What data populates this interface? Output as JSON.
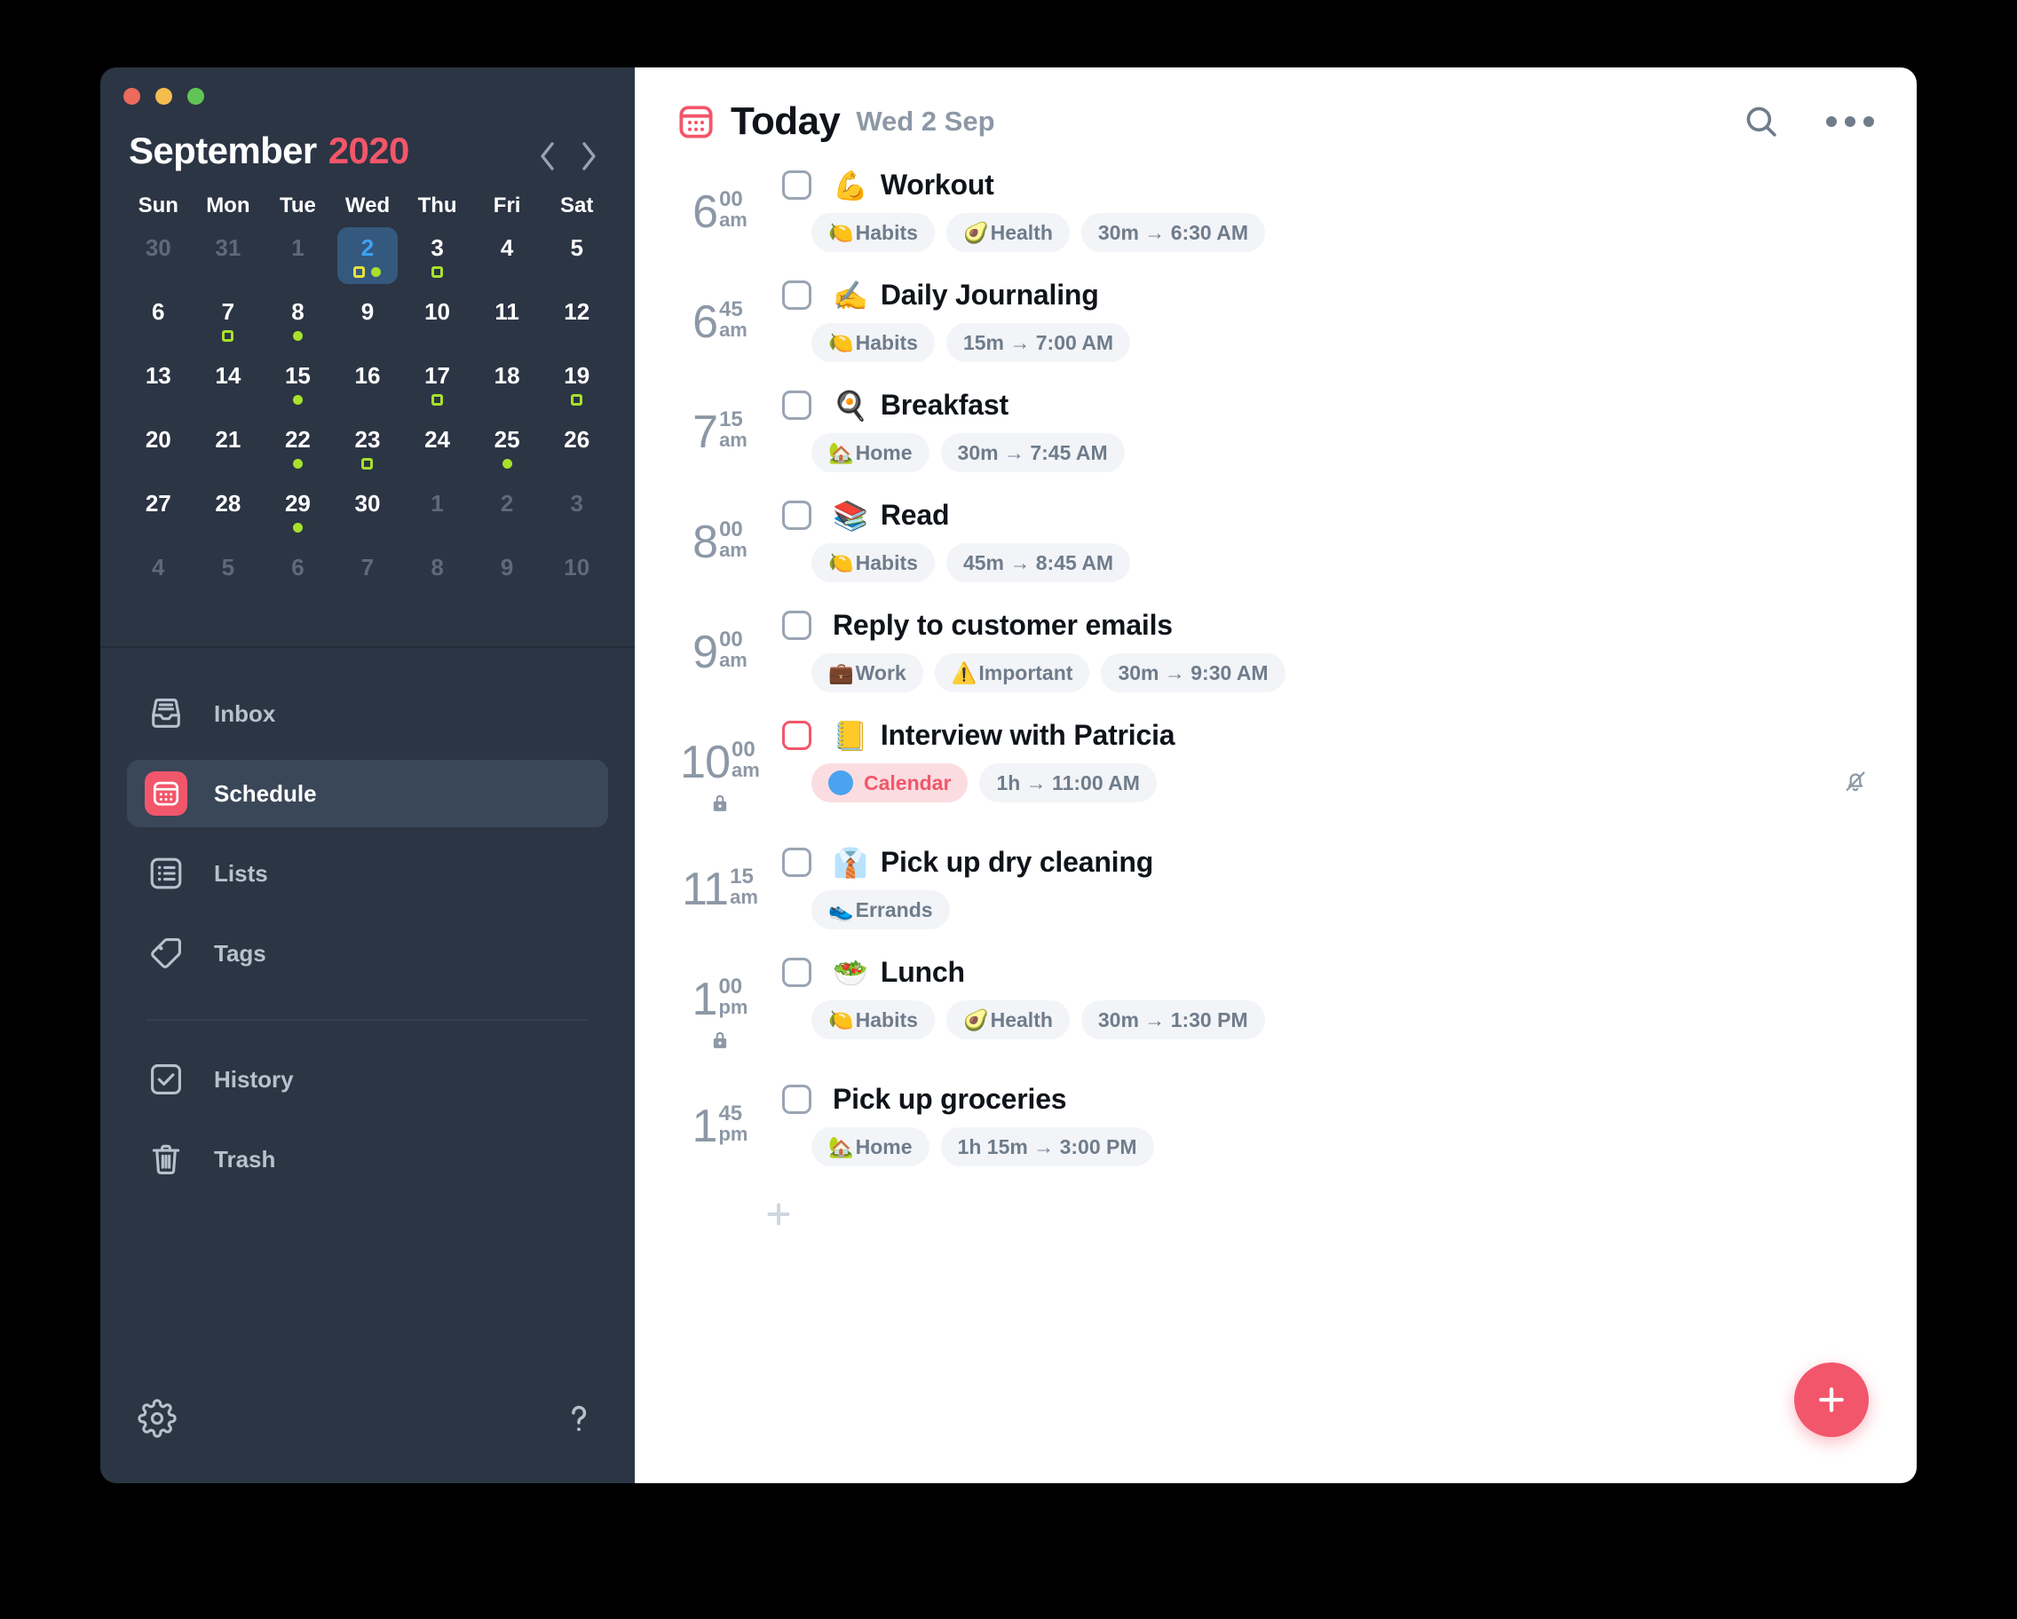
{
  "window": {
    "traffic_lights": [
      "close",
      "minimize",
      "zoom"
    ]
  },
  "sidebar": {
    "calendar": {
      "month": "September",
      "year": "2020",
      "prev_label": "Previous month",
      "next_label": "Next month",
      "weekdays": [
        "Sun",
        "Mon",
        "Tue",
        "Wed",
        "Thu",
        "Fri",
        "Sat"
      ],
      "weeks": [
        [
          {
            "day": "30",
            "muted": true,
            "marks": []
          },
          {
            "day": "31",
            "muted": true,
            "marks": []
          },
          {
            "day": "1",
            "muted": true,
            "marks": []
          },
          {
            "day": "2",
            "muted": false,
            "selected": true,
            "marks": [
              "square",
              "dot"
            ]
          },
          {
            "day": "3",
            "muted": false,
            "marks": [
              "square"
            ]
          },
          {
            "day": "4",
            "muted": false,
            "marks": []
          },
          {
            "day": "5",
            "muted": false,
            "marks": []
          }
        ],
        [
          {
            "day": "6",
            "muted": false,
            "marks": []
          },
          {
            "day": "7",
            "muted": false,
            "marks": [
              "square"
            ]
          },
          {
            "day": "8",
            "muted": false,
            "marks": [
              "dot"
            ]
          },
          {
            "day": "9",
            "muted": false,
            "marks": []
          },
          {
            "day": "10",
            "muted": false,
            "marks": []
          },
          {
            "day": "11",
            "muted": false,
            "marks": []
          },
          {
            "day": "12",
            "muted": false,
            "marks": []
          }
        ],
        [
          {
            "day": "13",
            "muted": false,
            "marks": []
          },
          {
            "day": "14",
            "muted": false,
            "marks": []
          },
          {
            "day": "15",
            "muted": false,
            "marks": [
              "dot"
            ]
          },
          {
            "day": "16",
            "muted": false,
            "marks": []
          },
          {
            "day": "17",
            "muted": false,
            "marks": [
              "square"
            ]
          },
          {
            "day": "18",
            "muted": false,
            "marks": []
          },
          {
            "day": "19",
            "muted": false,
            "marks": [
              "square"
            ]
          }
        ],
        [
          {
            "day": "20",
            "muted": false,
            "marks": []
          },
          {
            "day": "21",
            "muted": false,
            "marks": []
          },
          {
            "day": "22",
            "muted": false,
            "marks": [
              "dot"
            ]
          },
          {
            "day": "23",
            "muted": false,
            "marks": [
              "square"
            ]
          },
          {
            "day": "24",
            "muted": false,
            "marks": []
          },
          {
            "day": "25",
            "muted": false,
            "marks": [
              "dot"
            ]
          },
          {
            "day": "26",
            "muted": false,
            "marks": []
          }
        ],
        [
          {
            "day": "27",
            "muted": false,
            "marks": []
          },
          {
            "day": "28",
            "muted": false,
            "marks": []
          },
          {
            "day": "29",
            "muted": false,
            "marks": [
              "dot"
            ]
          },
          {
            "day": "30",
            "muted": false,
            "marks": []
          },
          {
            "day": "1",
            "muted": true,
            "marks": []
          },
          {
            "day": "2",
            "muted": true,
            "marks": []
          },
          {
            "day": "3",
            "muted": true,
            "marks": []
          }
        ],
        [
          {
            "day": "4",
            "muted": true,
            "marks": []
          },
          {
            "day": "5",
            "muted": true,
            "marks": []
          },
          {
            "day": "6",
            "muted": true,
            "marks": []
          },
          {
            "day": "7",
            "muted": true,
            "marks": []
          },
          {
            "day": "8",
            "muted": true,
            "marks": []
          },
          {
            "day": "9",
            "muted": true,
            "marks": []
          },
          {
            "day": "10",
            "muted": true,
            "marks": []
          }
        ]
      ]
    },
    "nav_primary": [
      {
        "label": "Inbox",
        "icon": "inbox-icon",
        "active": false
      },
      {
        "label": "Schedule",
        "icon": "calendar-icon",
        "active": true
      },
      {
        "label": "Lists",
        "icon": "list-icon",
        "active": false
      },
      {
        "label": "Tags",
        "icon": "tag-icon",
        "active": false
      }
    ],
    "nav_secondary": [
      {
        "label": "History",
        "icon": "history-icon",
        "active": false
      },
      {
        "label": "Trash",
        "icon": "trash-icon",
        "active": false
      }
    ],
    "footer": [
      {
        "icon": "gear-icon",
        "label": "Settings"
      },
      {
        "icon": "help-icon",
        "label": "Help"
      }
    ]
  },
  "main": {
    "header": {
      "icon": "calendar-icon",
      "title": "Today",
      "subtitle": "Wed 2 Sep",
      "search_label": "Search",
      "more_label": "More options"
    },
    "add_row_label": "Add task",
    "fab_label": "New task",
    "tasks": [
      {
        "time_hour": "6",
        "time_min": "00",
        "time_period": "am",
        "locked": false,
        "checked": false,
        "checkbox_style": "default",
        "emoji": "💪",
        "title": "Workout",
        "pills": [
          {
            "emoji": "🍋",
            "label": "Habits",
            "style": "default"
          },
          {
            "emoji": "🥑",
            "label": "Health",
            "style": "default"
          },
          {
            "emoji": "",
            "label": "30m → 6:30 AM",
            "style": "default"
          }
        ],
        "muted_bell": false
      },
      {
        "time_hour": "6",
        "time_min": "45",
        "time_period": "am",
        "locked": false,
        "checked": false,
        "checkbox_style": "default",
        "emoji": "✍️",
        "title": "Daily Journaling",
        "pills": [
          {
            "emoji": "🍋",
            "label": "Habits",
            "style": "default"
          },
          {
            "emoji": "",
            "label": "15m → 7:00 AM",
            "style": "default"
          }
        ],
        "muted_bell": false
      },
      {
        "time_hour": "7",
        "time_min": "15",
        "time_period": "am",
        "locked": false,
        "checked": false,
        "checkbox_style": "default",
        "emoji": "🍳",
        "title": "Breakfast",
        "pills": [
          {
            "emoji": "🏡",
            "label": "Home",
            "style": "default"
          },
          {
            "emoji": "",
            "label": "30m → 7:45 AM",
            "style": "default"
          }
        ],
        "muted_bell": false
      },
      {
        "time_hour": "8",
        "time_min": "00",
        "time_period": "am",
        "locked": false,
        "checked": false,
        "checkbox_style": "default",
        "emoji": "📚",
        "title": "Read",
        "pills": [
          {
            "emoji": "🍋",
            "label": "Habits",
            "style": "default"
          },
          {
            "emoji": "",
            "label": "45m → 8:45 AM",
            "style": "default"
          }
        ],
        "muted_bell": false
      },
      {
        "time_hour": "9",
        "time_min": "00",
        "time_period": "am",
        "locked": false,
        "checked": false,
        "checkbox_style": "default",
        "emoji": "",
        "title": "Reply to customer emails",
        "pills": [
          {
            "emoji": "💼",
            "label": "Work",
            "style": "default"
          },
          {
            "emoji": "⚠️",
            "label": "Important",
            "style": "default"
          },
          {
            "emoji": "",
            "label": "30m → 9:30 AM",
            "style": "default"
          }
        ],
        "muted_bell": false
      },
      {
        "time_hour": "10",
        "time_min": "00",
        "time_period": "am",
        "locked": true,
        "checked": false,
        "checkbox_style": "red",
        "emoji": "📒",
        "title": "Interview with Patricia",
        "pills": [
          {
            "emoji": "",
            "label": "Calendar",
            "style": "calendar"
          },
          {
            "emoji": "",
            "label": "1h → 11:00 AM",
            "style": "default"
          }
        ],
        "muted_bell": true
      },
      {
        "time_hour": "11",
        "time_min": "15",
        "time_period": "am",
        "locked": false,
        "checked": false,
        "checkbox_style": "default",
        "emoji": "👔",
        "title": "Pick up dry cleaning",
        "pills": [
          {
            "emoji": "👟",
            "label": "Errands",
            "style": "default"
          }
        ],
        "muted_bell": false
      },
      {
        "time_hour": "1",
        "time_min": "00",
        "time_period": "pm",
        "locked": true,
        "checked": false,
        "checkbox_style": "default",
        "emoji": "🥗",
        "title": "Lunch",
        "pills": [
          {
            "emoji": "🍋",
            "label": "Habits",
            "style": "default"
          },
          {
            "emoji": "🥑",
            "label": "Health",
            "style": "default"
          },
          {
            "emoji": "",
            "label": "30m → 1:30 PM",
            "style": "default"
          }
        ],
        "muted_bell": false
      },
      {
        "time_hour": "1",
        "time_min": "45",
        "time_period": "pm",
        "locked": false,
        "checked": false,
        "checkbox_style": "default",
        "emoji": "",
        "title": "Pick up groceries",
        "pills": [
          {
            "emoji": "🏡",
            "label": "Home",
            "style": "default"
          },
          {
            "emoji": "",
            "label": "1h 15m → 3:00 PM",
            "style": "default"
          }
        ],
        "muted_bell": false
      }
    ]
  },
  "colors": {
    "accent": "#f2566a",
    "sidebar_bg": "#2b3544",
    "selected_day_bg": "#35597e",
    "selected_day_text": "#3ba3f7",
    "marker_green": "#a8e02c",
    "marker_yellow": "#e8e13a",
    "pill_bg": "#f2f4f7",
    "pill_text": "#6f7c8c"
  }
}
